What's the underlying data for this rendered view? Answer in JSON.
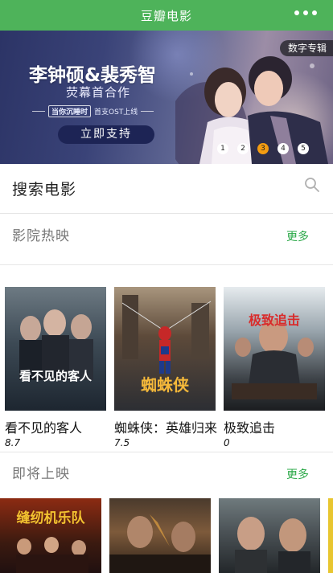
{
  "navbar": {
    "title": "豆瓣电影"
  },
  "banner": {
    "headline": "李钟硕&裴秀智",
    "subline": "荧幕首合作",
    "ost_tag": "当你沉睡时",
    "ost_text": "首支OST上线",
    "button": "立即支持",
    "album_tag": "数字专辑",
    "dots": [
      "1",
      "2",
      "3",
      "4",
      "5"
    ],
    "active_dot": 3
  },
  "search": {
    "label": "搜索电影"
  },
  "in_theaters": {
    "title": "影院热映",
    "more": "更多",
    "movies": [
      {
        "title": "看不见的客人",
        "rating": "8.7",
        "poster_text": "看不见的客人"
      },
      {
        "title": "蜘蛛侠：英雄归来",
        "rating": "7.5",
        "poster_text": "蜘蛛侠"
      },
      {
        "title": "极致追击",
        "rating": "0",
        "poster_text": "极致追击"
      }
    ]
  },
  "coming_soon": {
    "title": "即将上映",
    "more": "更多",
    "posters": [
      "缝纫机乐队",
      "",
      ""
    ]
  },
  "colors": {
    "brand_green": "#4eb35a",
    "link_green": "#2aa847",
    "active_dot": "#f39c12"
  }
}
